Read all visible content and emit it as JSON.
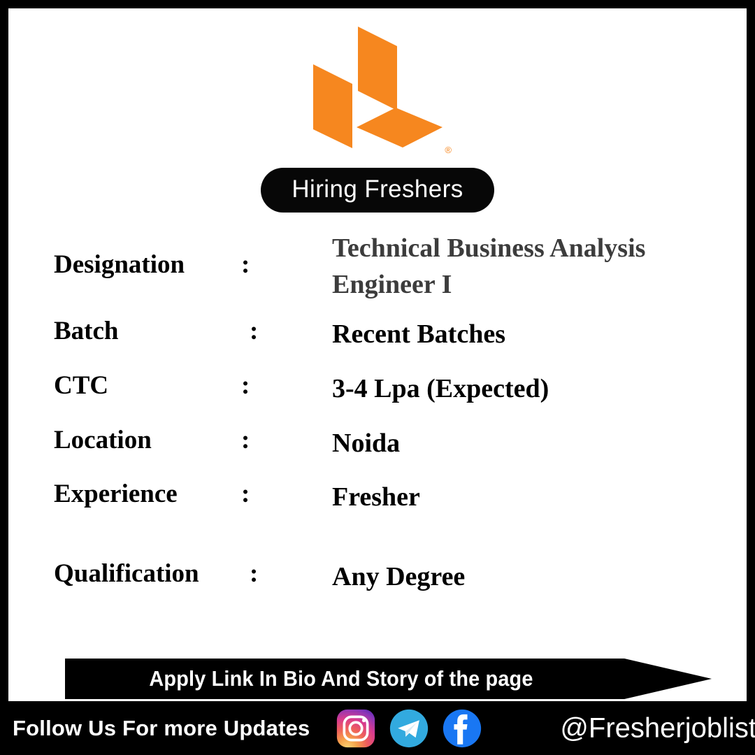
{
  "brand": {
    "logo_icon": "orange-cube-logo",
    "logo_color": "#F6871F",
    "trademark_mark": "®"
  },
  "badge": {
    "label": "Hiring Freshers",
    "background": "#070707",
    "text_color": "#FFFFFF"
  },
  "details": {
    "separator": ":",
    "rows": [
      {
        "label": "Designation",
        "value": "Technical Business Analysis Engineer I",
        "value_color": "#3C3C3C"
      },
      {
        "label": "Batch",
        "value": "Recent Batches",
        "value_color": "#000000"
      },
      {
        "label": "CTC",
        "value": "3-4  Lpa (Expected)",
        "value_color": "#000000"
      },
      {
        "label": "Location",
        "value": "Noida",
        "value_color": "#000000"
      },
      {
        "label": "Experience",
        "value": "Fresher",
        "value_color": "#000000"
      },
      {
        "label": "Qualification",
        "value": "Any Degree",
        "value_color": "#000000"
      }
    ]
  },
  "banner": {
    "text": "Apply Link In Bio And Story of the page",
    "background": "#000000",
    "text_color": "#FFFFFF"
  },
  "footer": {
    "follow_text": "Follow Us For more Updates",
    "handle": "@Fresherjoblist",
    "background": "#000000",
    "text_color": "#FFFFFF",
    "social": [
      {
        "name": "instagram-icon",
        "label": "Instagram"
      },
      {
        "name": "telegram-icon",
        "label": "Telegram"
      },
      {
        "name": "facebook-icon",
        "label": "Facebook"
      }
    ]
  }
}
